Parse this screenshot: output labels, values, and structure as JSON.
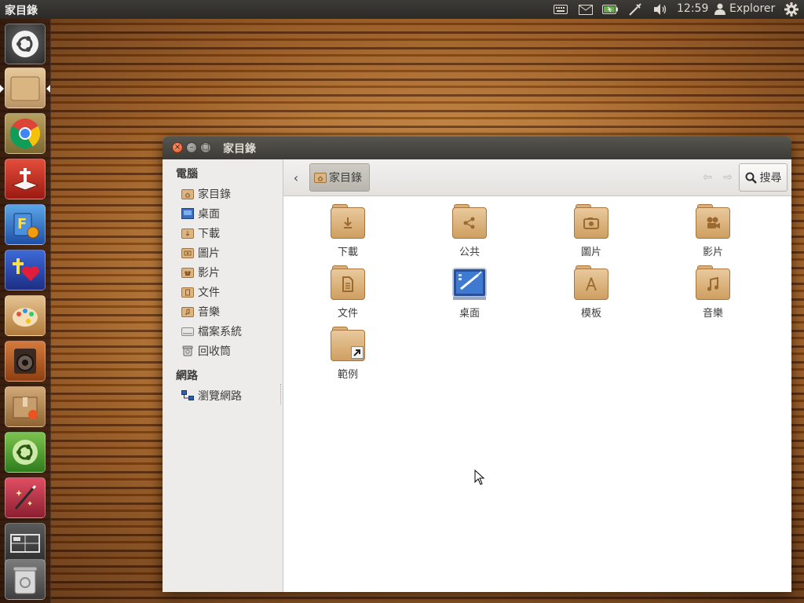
{
  "top_panel": {
    "title": "家目錄",
    "clock": "12:59",
    "user": "Explorer",
    "indicators": [
      "keyboard-icon",
      "mail-icon",
      "battery-icon",
      "network-icon",
      "volume-icon",
      "user-icon",
      "gear-icon"
    ]
  },
  "launcher": {
    "items": [
      {
        "name": "ubuntu-dash",
        "icon": "ubuntu-icon"
      },
      {
        "name": "files",
        "icon": "folder-icon"
      },
      {
        "name": "chrome",
        "icon": "chrome-icon"
      },
      {
        "name": "bible",
        "icon": "bible-icon"
      },
      {
        "name": "learning",
        "icon": "book-icon"
      },
      {
        "name": "faith",
        "icon": "cross-heart-icon"
      },
      {
        "name": "paint",
        "icon": "paint-icon"
      },
      {
        "name": "sound",
        "icon": "speaker-icon"
      },
      {
        "name": "package",
        "icon": "package-icon"
      },
      {
        "name": "software-center",
        "icon": "software-center-icon"
      },
      {
        "name": "magic",
        "icon": "magic-wand-icon"
      },
      {
        "name": "workspace-switcher",
        "icon": "workspace-icon"
      },
      {
        "name": "trash",
        "icon": "trash-icon"
      }
    ]
  },
  "window": {
    "title": "家目錄",
    "sidebar": {
      "computer_header": "電腦",
      "computer_items": [
        {
          "label": "家目錄",
          "icon": "home-folder-icon"
        },
        {
          "label": "桌面",
          "icon": "desktop-icon"
        },
        {
          "label": "下載",
          "icon": "downloads-folder-icon"
        },
        {
          "label": "圖片",
          "icon": "pictures-folder-icon"
        },
        {
          "label": "影片",
          "icon": "videos-folder-icon"
        },
        {
          "label": "文件",
          "icon": "documents-folder-icon"
        },
        {
          "label": "音樂",
          "icon": "music-folder-icon"
        },
        {
          "label": "檔案系統",
          "icon": "drive-icon"
        },
        {
          "label": "回收筒",
          "icon": "trash-icon"
        }
      ],
      "network_header": "網路",
      "network_items": [
        {
          "label": "瀏覽網路",
          "icon": "network-icon"
        }
      ]
    },
    "toolbar": {
      "breadcrumb": "家目錄",
      "search_label": "搜尋"
    },
    "files": [
      {
        "label": "下載",
        "icon": "downloads-folder-icon"
      },
      {
        "label": "公共",
        "icon": "public-folder-icon"
      },
      {
        "label": "圖片",
        "icon": "pictures-folder-icon"
      },
      {
        "label": "影片",
        "icon": "videos-folder-icon"
      },
      {
        "label": "文件",
        "icon": "documents-folder-icon"
      },
      {
        "label": "桌面",
        "icon": "desktop-icon"
      },
      {
        "label": "模板",
        "icon": "templates-folder-icon"
      },
      {
        "label": "音樂",
        "icon": "music-folder-icon"
      },
      {
        "label": "範例",
        "icon": "examples-folder-icon"
      }
    ]
  }
}
